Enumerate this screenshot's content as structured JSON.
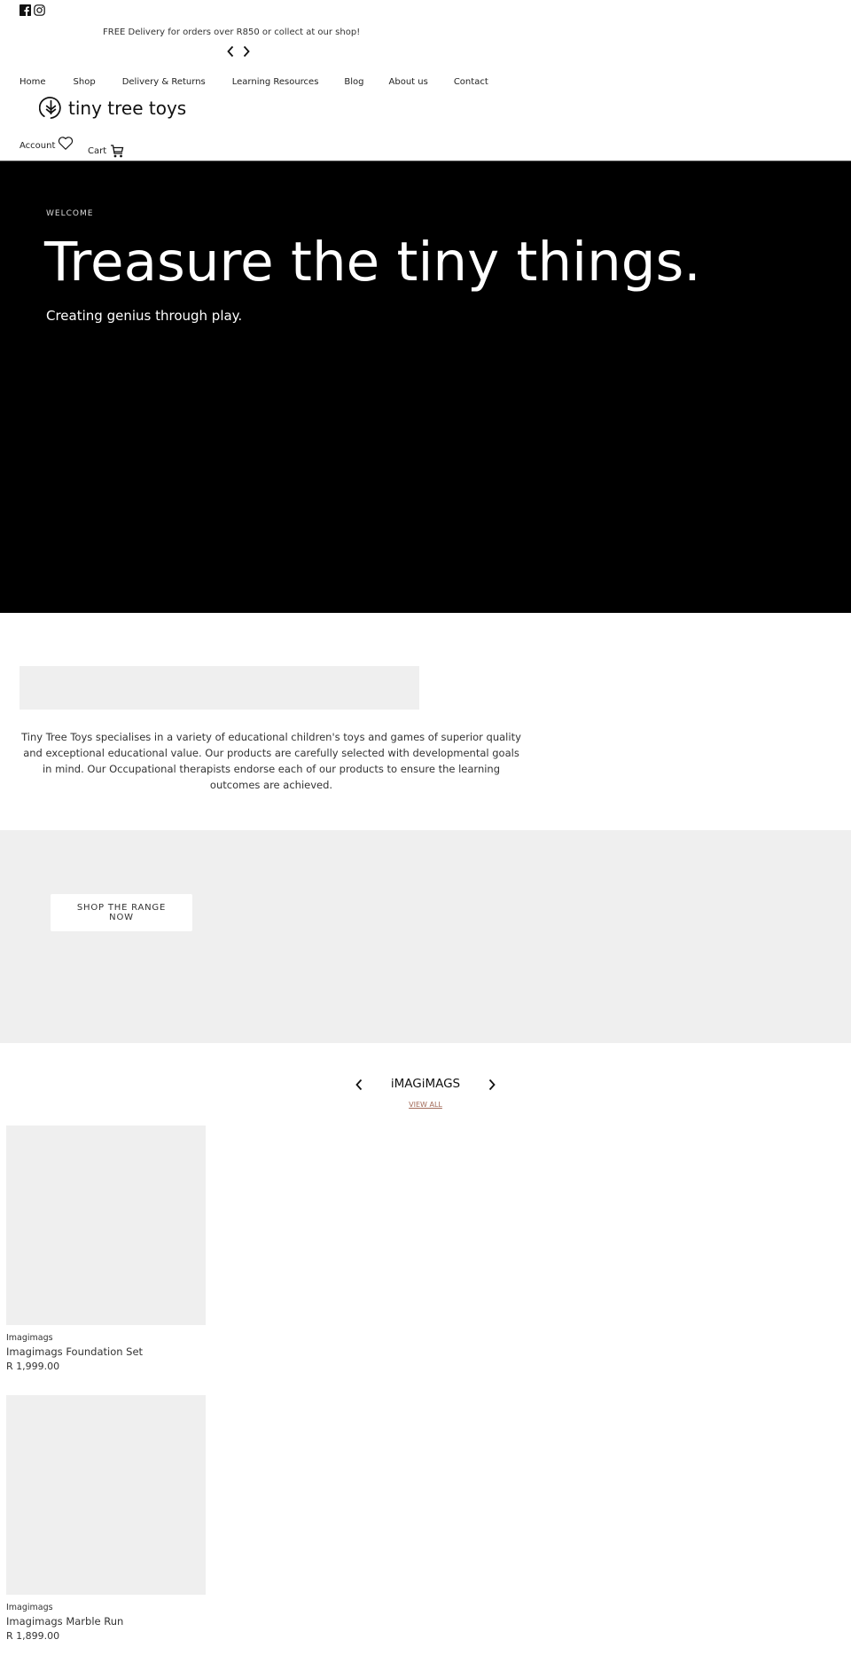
{
  "header": {
    "social": [
      {
        "icon": "facebook-icon",
        "label": "Facebook"
      },
      {
        "icon": "instagram-icon",
        "label": "Instagram"
      }
    ],
    "announcement": "FREE Delivery for orders over R850 or collect at our shop!",
    "nav": [
      "Home",
      "Shop",
      "Delivery & Returns",
      "Learning Resources",
      "Blog",
      "About us",
      "Contact"
    ],
    "logo_text": "tiny tree toys",
    "account_label": "Account",
    "cart_label": "Cart"
  },
  "hero": {
    "eyebrow": "WELCOME",
    "title": "Treasure the tiny things.",
    "subtitle": "Creating genius through play."
  },
  "intro": {
    "text": "Tiny Tree Toys specialises in a variety of educational children's toys and games of superior quality and exceptional educational value. Our products are carefully selected with developmental goals in mind. Our Occupational therapists endorse each of our products to ensure the learning outcomes are achieved."
  },
  "promo": {
    "button_label": "SHOP THE RANGE NOW"
  },
  "collection": {
    "title": "iMAGiMAGS",
    "view_all": "VIEW ALL",
    "accent_color": "#a26a58",
    "products": [
      {
        "vendor": "Imagimags",
        "name": "Imagimags Foundation Set",
        "price": "R 1,999.00"
      },
      {
        "vendor": "Imagimags",
        "name": "Imagimags Marble Run",
        "price": "R 1,899.00"
      }
    ]
  }
}
